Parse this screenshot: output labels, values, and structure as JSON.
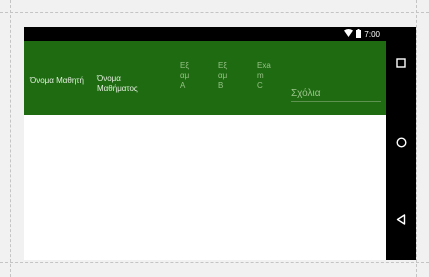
{
  "status": {
    "time": "7:00"
  },
  "table": {
    "headers": [
      "Όνομα Μαθητή",
      "Όνομα Μαθήματος",
      "Εξ αμ Α",
      "Εξ αμ Β",
      "Exa m C"
    ],
    "notes_placeholder": "Σχόλια"
  },
  "navbar": {
    "buttons": [
      "recent-apps",
      "home",
      "back"
    ]
  },
  "colors": {
    "toolbar": "#1e6b12",
    "statusbar": "#000000"
  }
}
